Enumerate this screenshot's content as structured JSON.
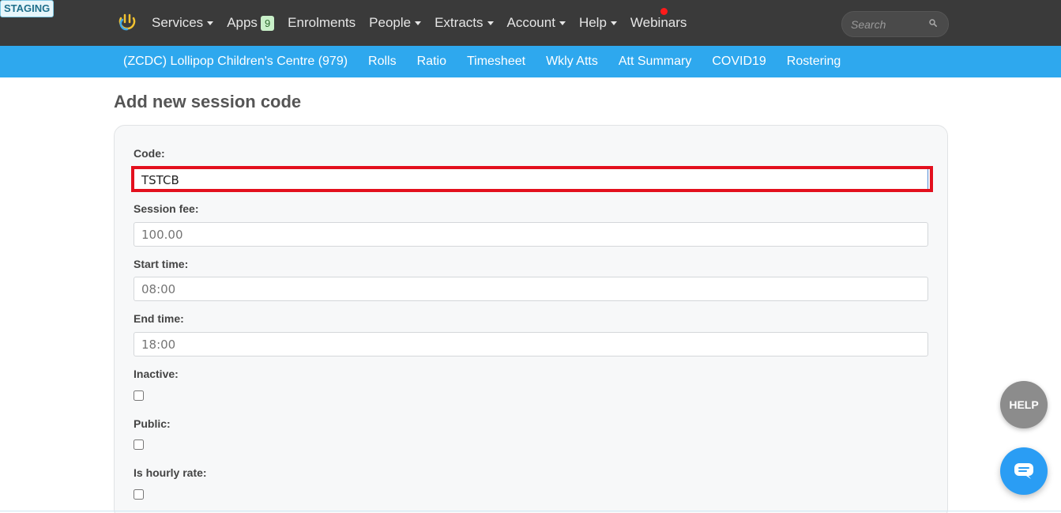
{
  "environment_badge": "STAGING",
  "topnav": {
    "items": [
      {
        "label": "Services",
        "dropdown": true
      },
      {
        "label": "Apps",
        "badge": "9",
        "dropdown": false
      },
      {
        "label": "Enrolments",
        "dropdown": false
      },
      {
        "label": "People",
        "dropdown": true
      },
      {
        "label": "Extracts",
        "dropdown": true
      },
      {
        "label": "Account",
        "dropdown": true
      },
      {
        "label": "Help",
        "dropdown": true
      },
      {
        "label": "Webinars",
        "dropdown": false
      }
    ],
    "search_placeholder": "Search"
  },
  "subnav": {
    "items": [
      "(ZCDC) Lollipop Children's Centre (979)",
      "Rolls",
      "Ratio",
      "Timesheet",
      "Wkly Atts",
      "Att Summary",
      "COVID19",
      "Rostering"
    ]
  },
  "page_title": "Add new session code",
  "form": {
    "code_label": "Code:",
    "code_value": "TSTCB",
    "fee_label": "Session fee:",
    "fee_placeholder": "100.00",
    "start_label": "Start time:",
    "start_placeholder": "08:00",
    "end_label": "End time:",
    "end_placeholder": "18:00",
    "inactive_label": "Inactive:",
    "public_label": "Public:",
    "hourly_label": "Is hourly rate:"
  },
  "help_button_label": "HELP",
  "colors": {
    "topbar": "#3a3a3a",
    "subnav": "#2ea8ee",
    "highlight": "#e3101e",
    "chat_button": "#2a9df4"
  }
}
